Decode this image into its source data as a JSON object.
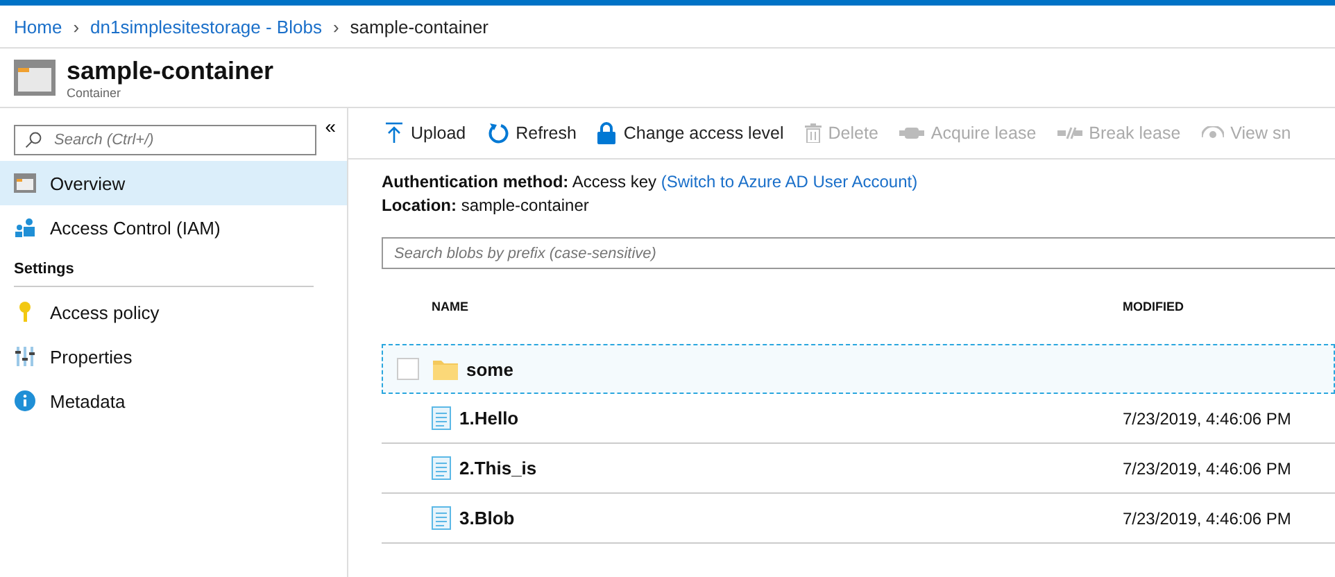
{
  "breadcrumb": [
    {
      "label": "Home",
      "link": true
    },
    {
      "separator": "›",
      "label": "dn1simplesitestorage - Blobs",
      "link": true
    },
    {
      "separator": "›",
      "label": "sample-container",
      "link": false
    }
  ],
  "header": {
    "title": "sample-container",
    "subtitle": "Container"
  },
  "sidebar": {
    "search": {
      "placeholder": "Search (Ctrl+/)"
    },
    "collapse": "«",
    "sections": [
      {
        "items": [
          {
            "label": "Overview",
            "selected": true
          },
          {
            "label": "Access Control (IAM)",
            "selected": false
          }
        ]
      },
      {
        "heading": "Settings",
        "items": [
          {
            "label": "Access policy",
            "selected": false
          },
          {
            "label": "Properties",
            "selected": false
          },
          {
            "label": "Metadata",
            "selected": false
          }
        ]
      }
    ]
  },
  "toolbar": [
    {
      "label": "Upload",
      "disabled": false
    },
    {
      "label": "Refresh",
      "disabled": false
    },
    {
      "label": "Change access level",
      "disabled": false
    },
    {
      "label": "Delete",
      "disabled": true
    },
    {
      "label": "Acquire lease",
      "disabled": true
    },
    {
      "label": "Break lease",
      "disabled": true
    },
    {
      "label": "View sn",
      "disabled": true
    }
  ],
  "info": {
    "auth_label": "Authentication method:",
    "auth_value": "Access key",
    "auth_link": "(Switch to Azure AD User Account)",
    "location_label": "Location:",
    "location_value": "sample-container"
  },
  "blob_search": {
    "placeholder": "Search blobs by prefix (case-sensitive)"
  },
  "table": {
    "columns": [
      "NAME",
      "MODIFIED"
    ],
    "rows": [
      {
        "kind": "folder",
        "name": "some",
        "selected": true,
        "checked": false
      },
      {
        "kind": "file",
        "name": "1.Hello",
        "modified": "7/23/2019, 4:46:06 PM",
        "selected": false
      },
      {
        "kind": "file",
        "name": "2.This_is",
        "modified": "7/23/2019, 4:46:06 PM",
        "selected": false
      },
      {
        "kind": "file",
        "name": "3.Blob",
        "modified": "7/23/2019, 4:46:06 PM",
        "selected": false
      }
    ]
  }
}
